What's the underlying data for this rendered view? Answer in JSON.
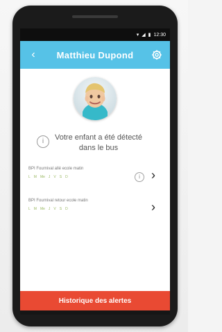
{
  "status_bar": {
    "time": "12:30"
  },
  "appbar": {
    "back_icon": "chevron-left-icon",
    "title": "Matthieu Dupond",
    "settings_icon": "gear-icon",
    "accent_color": "#56c2e7"
  },
  "profile": {
    "avatar_icon": "child-avatar-icon"
  },
  "alert": {
    "icon": "info-icon",
    "text": "Votre enfant a été détecté\ndans le bus"
  },
  "trips": [
    {
      "title": "BPI Fournival allé ecole matin",
      "days": [
        "L",
        "M",
        "Me",
        "J",
        "V",
        "S",
        "D"
      ],
      "info_icon": "info-icon",
      "chevron_icon": "chevron-right-icon"
    },
    {
      "title": "BPI Fournival retour ecole matin",
      "days": [
        "L",
        "M",
        "Me",
        "J",
        "V",
        "S",
        "D"
      ],
      "chevron_icon": "chevron-right-icon"
    }
  ],
  "footer": {
    "button_label": "Historique des alertes",
    "button_color": "#e94a33"
  },
  "navigation": {
    "back_icon": "triangle-back-icon",
    "home_icon": "circle-home-icon",
    "recent_icon": "square-recent-icon"
  }
}
